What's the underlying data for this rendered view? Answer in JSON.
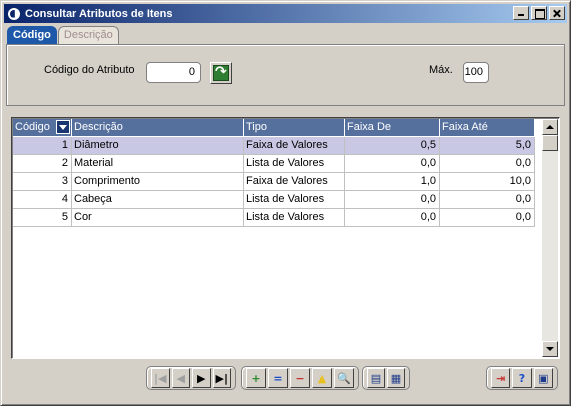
{
  "window": {
    "title": "Consultar Atributos de Itens"
  },
  "tabs": [
    {
      "label": "Código",
      "active": true
    },
    {
      "label": "Descrição",
      "active": false
    }
  ],
  "filter": {
    "codigo_label": "Código do Atributo",
    "codigo_value": "0",
    "max_label": "Máx.",
    "max_value": "100"
  },
  "grid": {
    "columns": [
      "Código",
      "Descrição",
      "Tipo",
      "Faixa De",
      "Faixa Até"
    ],
    "rows": [
      {
        "codigo": "1",
        "descricao": "Diâmetro",
        "tipo": "Faixa de Valores",
        "faixa_de": "0,5",
        "faixa_ate": "5,0"
      },
      {
        "codigo": "2",
        "descricao": "Material",
        "tipo": "Lista de Valores",
        "faixa_de": "0,0",
        "faixa_ate": "0,0"
      },
      {
        "codigo": "3",
        "descricao": "Comprimento",
        "tipo": "Faixa de Valores",
        "faixa_de": "1,0",
        "faixa_ate": "10,0"
      },
      {
        "codigo": "4",
        "descricao": "Cabeça",
        "tipo": "Lista de Valores",
        "faixa_de": "0,0",
        "faixa_ate": "0,0"
      },
      {
        "codigo": "5",
        "descricao": "Cor",
        "tipo": "Lista de Valores",
        "faixa_de": "0,0",
        "faixa_ate": "0,0"
      }
    ],
    "selected_row": 0
  },
  "toolbar": {
    "nav_buttons": [
      {
        "name": "first-record-icon",
        "glyph": "|◀",
        "enabled": false
      },
      {
        "name": "previous-record-icon",
        "glyph": "◀",
        "enabled": false
      },
      {
        "name": "next-record-icon",
        "glyph": "▶",
        "enabled": true
      },
      {
        "name": "last-record-icon",
        "glyph": "▶|",
        "enabled": true
      }
    ],
    "edit_buttons": [
      {
        "name": "add-icon",
        "glyph": "+",
        "color": "#2e8b2e"
      },
      {
        "name": "equal-icon",
        "glyph": "=",
        "color": "#1e4fc8"
      },
      {
        "name": "remove-icon",
        "glyph": "−",
        "color": "#c83232"
      },
      {
        "name": "filter-triangle-icon",
        "glyph": "▲",
        "color": "#e8c020"
      },
      {
        "name": "search-icon",
        "glyph": "🔍",
        "color": "#000000"
      }
    ],
    "view_buttons": [
      {
        "name": "grid-view-icon",
        "glyph": "▤",
        "color": "#1e3a8a"
      },
      {
        "name": "form-view-icon",
        "glyph": "▦",
        "color": "#1e3a8a"
      }
    ],
    "app_buttons": [
      {
        "name": "exit-icon",
        "glyph": "⇥",
        "color": "#c83232"
      },
      {
        "name": "help-icon",
        "glyph": "?",
        "color": "#1e4fc8"
      },
      {
        "name": "calendar-icon",
        "glyph": "▣",
        "color": "#1e3a8a"
      }
    ]
  }
}
